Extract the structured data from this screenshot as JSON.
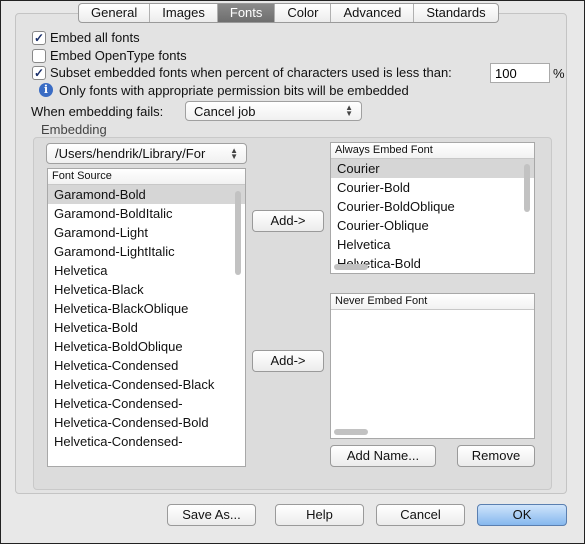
{
  "tabs": [
    {
      "label": "General"
    },
    {
      "label": "Images"
    },
    {
      "label": "Fonts",
      "selected": true
    },
    {
      "label": "Color"
    },
    {
      "label": "Advanced"
    },
    {
      "label": "Standards"
    }
  ],
  "options": {
    "embed_all": {
      "label": "Embed all fonts",
      "checked": true
    },
    "embed_opentype": {
      "label": "Embed OpenType fonts",
      "checked": false
    },
    "subset": {
      "label": "Subset embedded fonts when percent of characters used is less than:",
      "checked": true,
      "value": "100",
      "unit": "%"
    },
    "info": "Only fonts with appropriate permission bits will be embedded",
    "fail_label": "When embedding fails:",
    "fail_value": "Cancel job"
  },
  "embedding": {
    "title": "Embedding",
    "path": "/Users/hendrik/Library/For",
    "source_header": "Font Source",
    "source_fonts": [
      "Garamond-Bold",
      "Garamond-BoldItalic",
      "Garamond-Light",
      "Garamond-LightItalic",
      "Helvetica",
      "Helvetica-Black",
      "Helvetica-BlackOblique",
      "Helvetica-Bold",
      "Helvetica-BoldOblique",
      "Helvetica-Condensed",
      "Helvetica-Condensed-Black",
      "Helvetica-Condensed-",
      "Helvetica-Condensed-Bold",
      "Helvetica-Condensed-"
    ],
    "add_label": "Add->",
    "always_header": "Always Embed Font",
    "always_fonts": [
      "Courier",
      "Courier-Bold",
      "Courier-BoldOblique",
      "Courier-Oblique",
      "Helvetica",
      "Helvetica-Bold"
    ],
    "never_header": "Never Embed Font",
    "add_name": "Add Name...",
    "remove": "Remove"
  },
  "buttons": {
    "save_as": "Save As...",
    "help": "Help",
    "cancel": "Cancel",
    "ok": "OK"
  },
  "colors": {
    "accent": "#86b8ee",
    "selection": "#d6d6d6"
  }
}
